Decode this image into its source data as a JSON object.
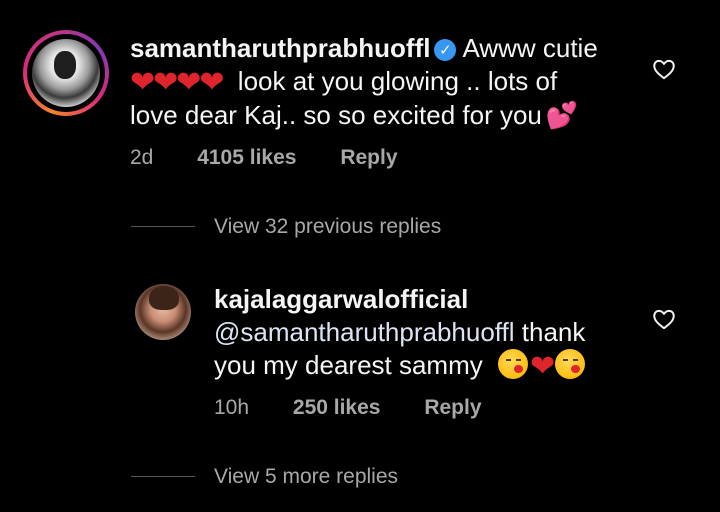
{
  "comment": {
    "username": "samantharuthprabhuoffl",
    "text_line1": "Awww cutie",
    "text_line2": "look at you glowing .. lots of",
    "text_line3": "love dear Kaj.. so so excited for you",
    "time": "2d",
    "likes": "4105 likes",
    "reply_label": "Reply",
    "emoji_red_heart": "❤",
    "emoji_two_hearts": "💕"
  },
  "view_previous": "View 32 previous replies",
  "reply": {
    "username": "kajalaggarwalofficial",
    "mention": "@samantharuthprabhuoffl",
    "text_line1_rest": " thank",
    "text_line2": "you my dearest sammy",
    "time": "10h",
    "likes": "250 likes",
    "reply_label": "Reply",
    "emoji_red_heart": "❤"
  },
  "view_more": "View 5 more replies",
  "colors": {
    "background": "#000000",
    "text_primary": "#f5f5f5",
    "text_secondary": "#a8a8a8",
    "verified_blue": "#3897f0",
    "heart_red": "#e0242c"
  },
  "icons": [
    "verified-badge-icon",
    "heart-outline-icon",
    "red-heart-emoji",
    "two-hearts-emoji",
    "kissing-face-emoji"
  ]
}
